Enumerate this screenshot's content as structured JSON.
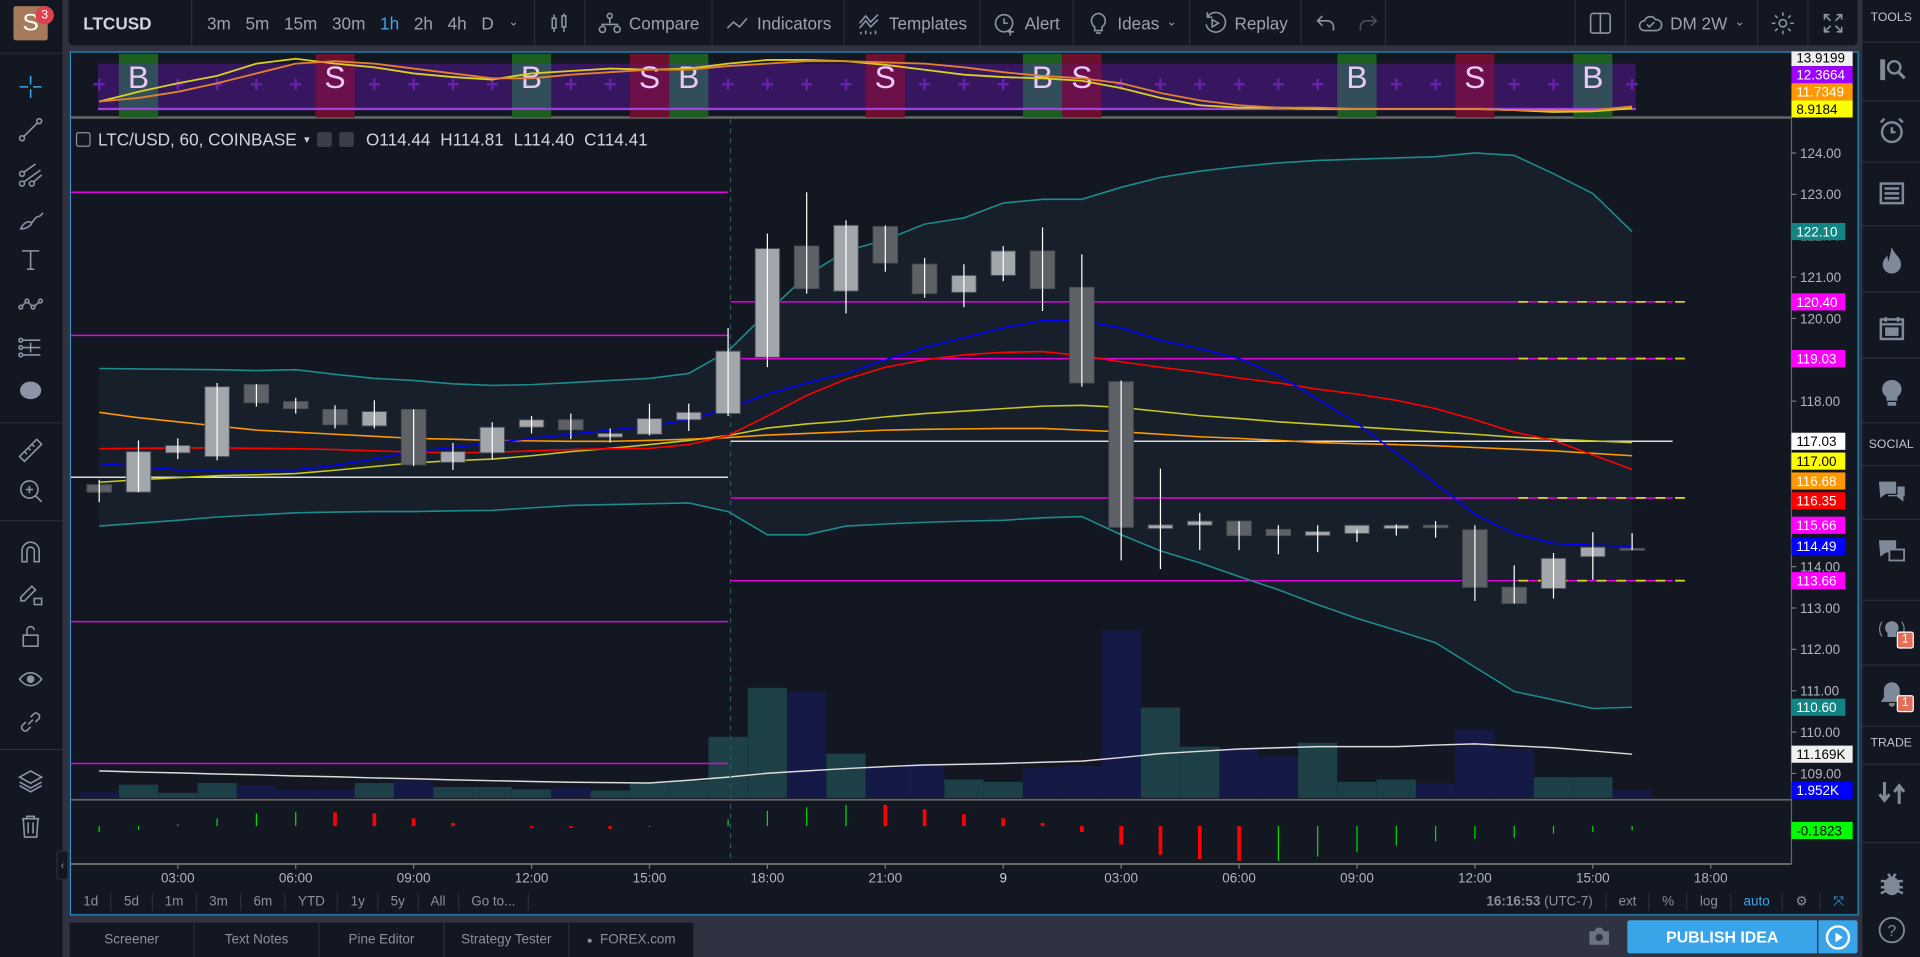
{
  "header": {
    "avatar_letter": "S",
    "avatar_badge": "3",
    "symbol": "LTCUSD",
    "intervals": [
      "3m",
      "5m",
      "15m",
      "30m",
      "1h",
      "2h",
      "4h",
      "D"
    ],
    "active_interval": "1h",
    "compare": "Compare",
    "indicators": "Indicators",
    "templates": "Templates",
    "alert": "Alert",
    "ideas": "Ideas",
    "replay": "Replay",
    "layout_name": "DM 2W"
  },
  "legend": {
    "title": "LTC/USD, 60, COINBASE",
    "open": "O114.44",
    "high": "H114.81",
    "low": "L114.40",
    "close": "C114.41"
  },
  "right_sidebar": {
    "tools_label": "TOOLS",
    "social_label": "SOCIAL",
    "trade_label": "TRADE",
    "ideas_stream_badge": "1",
    "alerts_badge": "1"
  },
  "range_bar": [
    "1d",
    "5d",
    "1m",
    "3m",
    "6m",
    "YTD",
    "1y",
    "5y",
    "All",
    "Go to..."
  ],
  "axis_controls": {
    "clock": "16:16:53",
    "timezone": "(UTC-7)",
    "ext": "ext",
    "percent": "%",
    "log": "log",
    "auto": "auto"
  },
  "bottom_tabs": [
    "Screener",
    "Text Notes",
    "Pine Editor",
    "Strategy Tester",
    "FOREX.com"
  ],
  "publish_label": "PUBLISH IDEA",
  "colors": {
    "accent": "#39a6e6",
    "up_candle": "#a3a6ab",
    "down_candle": "#5e6166",
    "bb": "#1f8a8a",
    "ma_blue": "#0000ff",
    "ma_red": "#ff0000",
    "ma_orange": "#ff9800",
    "ma_yellow": "#c8c820",
    "level": "#e000e0",
    "vol_up": "#1d3f46",
    "vol_down": "#141a45",
    "buy_signal": "#1b5e20",
    "sell_signal": "#6e0f2c",
    "signal_band": "#3a1666"
  },
  "chart_data": {
    "type": "candlestick",
    "symbol": "LTC/USD",
    "ylim": [
      108.5,
      124.4
    ],
    "y_ticks": [
      "124.00",
      "123.00",
      "122.00",
      "121.00",
      "120.00",
      "119.00",
      "118.00",
      "117.00",
      "116.00",
      "115.00",
      "114.00",
      "113.00",
      "112.00",
      "111.00",
      "110.00",
      "109.00"
    ],
    "x_ticks": [
      {
        "label": "03:00",
        "time": "8 03:00"
      },
      {
        "label": "06:00",
        "time": "8 06:00"
      },
      {
        "label": "09:00",
        "time": "8 09:00"
      },
      {
        "label": "12:00",
        "time": "8 12:00"
      },
      {
        "label": "15:00",
        "time": "8 15:00"
      },
      {
        "label": "18:00",
        "time": "8 18:00"
      },
      {
        "label": "21:00",
        "time": "8 21:00"
      },
      {
        "label": "9",
        "time": "9 00:00"
      },
      {
        "label": "03:00",
        "time": "9 03:00"
      },
      {
        "label": "06:00",
        "time": "9 06:00"
      },
      {
        "label": "09:00",
        "time": "9 09:00"
      },
      {
        "label": "12:00",
        "time": "9 12:00"
      },
      {
        "label": "15:00",
        "time": "9 15:00"
      },
      {
        "label": "18:00",
        "time": "9 18:00"
      }
    ],
    "candles_columns": [
      "time",
      "open",
      "high",
      "low",
      "close",
      "volume_k"
    ],
    "candles": [
      [
        "8 01:00",
        115.98,
        116.1,
        115.56,
        115.8,
        1.6
      ],
      [
        "8 02:00",
        115.8,
        117.05,
        115.8,
        116.78,
        3.4
      ],
      [
        "8 03:00",
        116.75,
        117.1,
        116.6,
        116.93,
        1.3
      ],
      [
        "8 04:00",
        116.66,
        118.44,
        116.57,
        118.35,
        3.8
      ],
      [
        "8 05:00",
        118.4,
        118.41,
        117.87,
        117.96,
        3.1
      ],
      [
        "8 06:00",
        117.99,
        118.08,
        117.7,
        117.82,
        2.2
      ],
      [
        "8 07:00",
        117.8,
        117.9,
        117.34,
        117.43,
        2.2
      ],
      [
        "8 08:00",
        117.4,
        118.02,
        117.34,
        117.75,
        3.8
      ],
      [
        "8 09:00",
        117.8,
        117.8,
        116.43,
        116.46,
        4.4
      ],
      [
        "8 10:00",
        116.52,
        116.99,
        116.34,
        116.78,
        2.8
      ],
      [
        "8 11:00",
        116.75,
        117.49,
        116.6,
        117.37,
        2.8
      ],
      [
        "8 12:00",
        117.37,
        117.64,
        117.22,
        117.55,
        2.2
      ],
      [
        "8 13:00",
        117.55,
        117.7,
        117.08,
        117.31,
        2.8
      ],
      [
        "8 14:00",
        117.13,
        117.34,
        117.0,
        117.22,
        1.9
      ],
      [
        "8 15:00",
        117.2,
        117.94,
        117.17,
        117.58,
        3.8
      ],
      [
        "8 16:00",
        117.55,
        117.94,
        117.28,
        117.73,
        4.4
      ],
      [
        "8 17:00",
        117.7,
        119.77,
        117.64,
        119.21,
        15.6
      ],
      [
        "8 18:00",
        119.06,
        122.05,
        118.82,
        121.69,
        28.1
      ],
      [
        "8 19:00",
        121.75,
        123.05,
        120.6,
        120.72,
        27.2
      ],
      [
        "8 20:00",
        120.66,
        122.37,
        120.12,
        122.25,
        11.3
      ],
      [
        "8 21:00",
        122.22,
        122.25,
        121.13,
        121.34,
        7.8
      ],
      [
        "8 22:00",
        121.31,
        121.46,
        120.5,
        120.6,
        8.8
      ],
      [
        "8 23:00",
        120.63,
        121.31,
        120.27,
        121.04,
        4.7
      ],
      [
        "9 00:00",
        121.04,
        121.75,
        120.9,
        121.63,
        4.1
      ],
      [
        "9 01:00",
        121.63,
        122.2,
        120.18,
        120.72,
        7.8
      ],
      [
        "9 02:00",
        120.75,
        121.55,
        118.35,
        118.44,
        8.1
      ],
      [
        "9 03:00",
        118.47,
        118.5,
        114.15,
        114.95,
        42.8
      ],
      [
        "9 04:00",
        114.92,
        116.37,
        113.94,
        115.01,
        23.1
      ],
      [
        "9 05:00",
        115.0,
        115.3,
        114.4,
        115.1,
        13.1
      ],
      [
        "9 06:00",
        115.1,
        115.1,
        114.4,
        114.75,
        12.5
      ],
      [
        "9 07:00",
        114.9,
        115.0,
        114.3,
        114.75,
        10.6
      ],
      [
        "9 08:00",
        114.75,
        115.0,
        114.35,
        114.85,
        14.1
      ],
      [
        "9 09:00",
        114.8,
        114.9,
        114.6,
        115.0,
        4.1
      ],
      [
        "9 10:00",
        114.92,
        115.02,
        114.75,
        115.0,
        4.7
      ],
      [
        "9 11:00",
        115.0,
        115.1,
        114.7,
        114.94,
        3.8
      ],
      [
        "9 12:00",
        114.89,
        115.0,
        113.17,
        113.5,
        17.5
      ],
      [
        "9 13:00",
        113.5,
        114.03,
        113.11,
        113.11,
        12.5
      ],
      [
        "9 14:00",
        113.47,
        114.33,
        113.23,
        114.2,
        5.3
      ],
      [
        "9 15:00",
        114.24,
        114.83,
        113.68,
        114.47,
        5.3
      ],
      [
        "9 16:00",
        114.44,
        114.81,
        114.4,
        114.41,
        1.952
      ]
    ],
    "overlays": {
      "bb_upper": [
        118.79,
        118.78,
        118.77,
        118.76,
        118.74,
        118.76,
        118.65,
        118.55,
        118.5,
        118.42,
        118.38,
        118.4,
        118.45,
        118.5,
        118.55,
        118.67,
        119.21,
        120.15,
        121.04,
        121.63,
        121.9,
        122.28,
        122.43,
        122.79,
        122.88,
        122.88,
        123.17,
        123.41,
        123.56,
        123.67,
        123.76,
        123.82,
        123.85,
        123.88,
        123.91,
        124.0,
        123.94,
        123.5,
        123.02,
        122.1
      ],
      "bb_lower": [
        114.98,
        115.05,
        115.12,
        115.2,
        115.25,
        115.3,
        115.32,
        115.33,
        115.33,
        115.35,
        115.36,
        115.42,
        115.48,
        115.5,
        115.52,
        115.54,
        115.33,
        114.77,
        114.77,
        114.98,
        115.03,
        115.07,
        115.1,
        115.12,
        115.18,
        115.21,
        114.77,
        114.38,
        114.09,
        113.76,
        113.44,
        113.08,
        112.75,
        112.46,
        112.16,
        111.57,
        110.98,
        110.78,
        110.57,
        110.6
      ],
      "ma_blue": [
        116.49,
        116.42,
        116.34,
        116.34,
        116.34,
        116.34,
        116.45,
        116.6,
        116.78,
        116.88,
        116.99,
        117.1,
        117.2,
        117.3,
        117.4,
        117.55,
        117.82,
        118.17,
        118.44,
        118.67,
        119.0,
        119.3,
        119.53,
        119.77,
        119.95,
        119.95,
        119.77,
        119.47,
        119.27,
        119.03,
        118.62,
        118.05,
        117.46,
        116.75,
        116.01,
        115.27,
        114.8,
        114.56,
        114.52,
        114.49
      ],
      "ma_red": [
        116.85,
        116.86,
        116.87,
        116.87,
        116.86,
        116.85,
        116.83,
        116.8,
        116.77,
        116.75,
        116.76,
        116.8,
        116.83,
        116.85,
        116.86,
        116.95,
        117.17,
        117.64,
        118.14,
        118.53,
        118.82,
        119.0,
        119.12,
        119.18,
        119.2,
        119.1,
        118.95,
        118.82,
        118.7,
        118.56,
        118.44,
        118.29,
        118.17,
        118.02,
        117.82,
        117.55,
        117.25,
        117.05,
        116.7,
        116.35
      ],
      "ma_orange": [
        117.73,
        117.6,
        117.5,
        117.4,
        117.3,
        117.25,
        117.2,
        117.15,
        117.1,
        117.08,
        117.05,
        117.04,
        117.03,
        117.03,
        117.05,
        117.08,
        117.12,
        117.18,
        117.22,
        117.26,
        117.3,
        117.32,
        117.33,
        117.34,
        117.34,
        117.3,
        117.26,
        117.2,
        117.14,
        117.1,
        117.05,
        117.0,
        116.97,
        116.95,
        116.92,
        116.88,
        116.84,
        116.8,
        116.74,
        116.68
      ],
      "ma_yellow": [
        116.04,
        116.1,
        116.15,
        116.2,
        116.22,
        116.25,
        116.33,
        116.42,
        116.51,
        116.56,
        116.6,
        116.68,
        116.78,
        116.86,
        116.95,
        117.05,
        117.17,
        117.35,
        117.45,
        117.52,
        117.62,
        117.7,
        117.76,
        117.82,
        117.88,
        117.9,
        117.85,
        117.75,
        117.65,
        117.58,
        117.5,
        117.44,
        117.38,
        117.32,
        117.26,
        117.2,
        117.13,
        117.08,
        117.04,
        117.0
      ],
      "volume_ma_k": [
        6.9,
        6.6,
        6.4,
        6.1,
        5.9,
        5.6,
        5.4,
        5.1,
        4.9,
        4.6,
        4.4,
        4.2,
        4.0,
        3.9,
        3.8,
        4.5,
        5.3,
        6.3,
        6.9,
        7.5,
        8.0,
        8.4,
        8.6,
        8.8,
        9.1,
        9.4,
        10.3,
        11.3,
        11.9,
        12.5,
        12.8,
        13.1,
        13.1,
        13.1,
        13.5,
        13.8,
        13.3,
        12.8,
        12.0,
        11.169
      ]
    },
    "levels": {
      "session_break": "8 17:00",
      "prior_magenta": [
        123.05,
        119.59,
        112.67,
        109.24
      ],
      "prior_white": 116.16,
      "current_magenta": [
        120.4,
        119.03,
        115.66,
        113.66
      ],
      "current_white": 117.03
    },
    "price_labels": [
      {
        "text": "122.10",
        "price": 122.1,
        "bg": "#138484",
        "fg": "#ffffff"
      },
      {
        "text": "120.40",
        "price": 120.4,
        "bg": "#ff00ff",
        "fg": "#ffffff"
      },
      {
        "text": "119.03",
        "price": 119.03,
        "bg": "#ff00ff",
        "fg": "#ffffff"
      },
      {
        "text": "117.03",
        "price": 117.03,
        "bg": "#ffffff",
        "fg": "#000000"
      },
      {
        "text": "117.00",
        "price": 116.55,
        "bg": "#ffff00",
        "fg": "#000000"
      },
      {
        "text": "116.68",
        "price": 116.07,
        "bg": "#ff9800",
        "fg": "#ffffff"
      },
      {
        "text": "116.35",
        "price": 115.59,
        "bg": "#ff0000",
        "fg": "#ffffff"
      },
      {
        "text": "115.66",
        "price": 115.0,
        "bg": "#ff00ff",
        "fg": "#ffffff"
      },
      {
        "text": "114.49",
        "price": 114.49,
        "bg": "#0000ff",
        "fg": "#ffffff"
      },
      {
        "text": "113.66",
        "price": 113.66,
        "bg": "#ff00ff",
        "fg": "#ffffff"
      },
      {
        "text": "110.60",
        "price": 110.6,
        "bg": "#138484",
        "fg": "#ffffff"
      }
    ],
    "volume_labels": [
      {
        "text": "11.169K",
        "value_k": 11.169,
        "bg": "#f0f0f0",
        "fg": "#000000"
      },
      {
        "text": "1.952K",
        "value_k": 1.952,
        "bg": "#0000ff",
        "fg": "#ffffff"
      }
    ],
    "oscillator": {
      "values": [
        -0.25,
        -0.15,
        0.07,
        0.32,
        0.53,
        0.59,
        0.57,
        0.53,
        0.32,
        0.13,
        0,
        -0.07,
        -0.07,
        -0.11,
        -0.04,
        0,
        0.28,
        0.63,
        0.78,
        0.88,
        0.88,
        0.69,
        0.49,
        0.32,
        0.13,
        -0.25,
        -0.77,
        -1.19,
        -1.37,
        -1.44,
        -1.44,
        -1.27,
        -1.09,
        -0.81,
        -0.63,
        -0.53,
        -0.48,
        -0.32,
        -0.25,
        -0.1823
      ],
      "colors": [
        "g",
        "g",
        "g",
        "g",
        "g",
        "g",
        "r",
        "r",
        "r",
        "r",
        "g",
        "r",
        "r",
        "r",
        "g",
        "g",
        "g",
        "g",
        "g",
        "g",
        "r",
        "r",
        "r",
        "r",
        "r",
        "r",
        "r",
        "r",
        "r",
        "r",
        "g",
        "g",
        "g",
        "g",
        "g",
        "g",
        "g",
        "g",
        "g",
        "g"
      ],
      "label": {
        "text": "-0.1823",
        "bg": "#00ff00",
        "fg": "#000000"
      }
    },
    "signal_pane": {
      "ylim": [
        7.64,
        16.48
      ],
      "yellow": [
        9.85,
        11.21,
        12.4,
        13.42,
        15.12,
        15.8,
        15.12,
        14.61,
        13.76,
        13.25,
        12.91,
        13.76,
        14.1,
        14.44,
        14.27,
        14.44,
        15.12,
        15.63,
        15.63,
        15.46,
        14.95,
        14.27,
        13.59,
        13.25,
        13.08,
        12.74,
        11.72,
        10.36,
        9.34,
        9.0,
        9.0,
        8.83,
        8.83,
        8.83,
        8.83,
        8.83,
        8.66,
        8.4,
        8.5,
        8.92
      ],
      "orange": [
        9.85,
        10.36,
        11.21,
        12.4,
        13.76,
        15.12,
        15.46,
        15.12,
        14.44,
        13.76,
        13.08,
        13.08,
        13.59,
        13.93,
        14.27,
        14.27,
        14.78,
        15.12,
        15.46,
        15.46,
        15.29,
        15.12,
        14.61,
        13.93,
        13.42,
        13.08,
        12.4,
        11.04,
        10.02,
        9.34,
        9.0,
        9.0,
        8.83,
        8.83,
        8.83,
        8.83,
        8.66,
        8.66,
        8.66,
        9.17
      ],
      "purple_level": 8.83,
      "signals": [
        {
          "type": "B",
          "time": "8 02:00"
        },
        {
          "type": "S",
          "time": "8 07:00"
        },
        {
          "type": "B",
          "time": "8 12:00"
        },
        {
          "type": "S",
          "time": "8 15:00"
        },
        {
          "type": "B",
          "time": "8 16:00"
        },
        {
          "type": "S",
          "time": "8 21:00"
        },
        {
          "type": "B",
          "time": "9 01:00"
        },
        {
          "type": "S",
          "time": "9 02:00"
        },
        {
          "type": "B",
          "time": "9 09:00"
        },
        {
          "type": "S",
          "time": "9 12:00"
        },
        {
          "type": "B",
          "time": "9 15:00"
        }
      ],
      "labels": [
        {
          "text": "13.9199",
          "bg": "#f0f0f0",
          "fg": "#000000"
        },
        {
          "text": "12.3664",
          "bg": "#9c00ff",
          "fg": "#ffffff"
        },
        {
          "text": "11.7349",
          "bg": "#ff9800",
          "fg": "#ffffff"
        },
        {
          "text": "8.9184",
          "bg": "#ffff00",
          "fg": "#000000"
        }
      ]
    }
  }
}
